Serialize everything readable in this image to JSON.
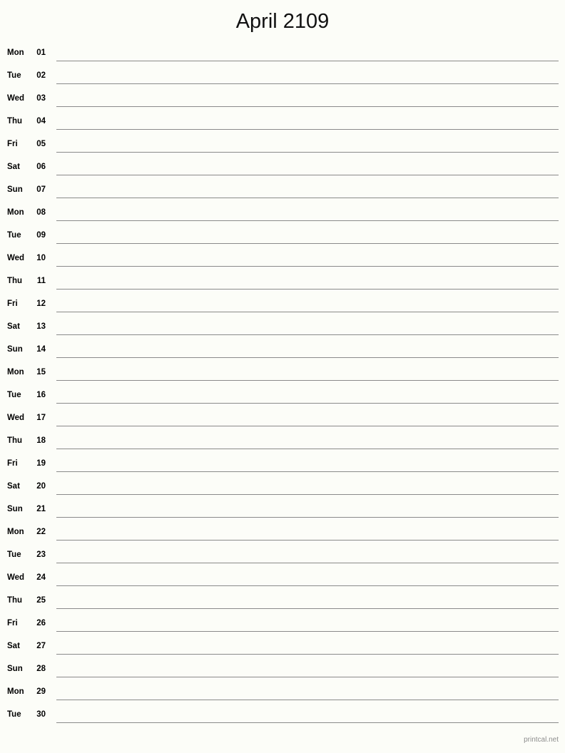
{
  "document": {
    "title": "April 2109",
    "month": "April",
    "year": "2109",
    "type": "printable-monthly-notes-calendar"
  },
  "footer": {
    "text": "printcal.net"
  },
  "colors": {
    "background": "#fcfdf8",
    "text": "#000000",
    "rule_line": "#8a8a8a",
    "footer_text": "#8d8d8d"
  },
  "days": [
    {
      "weekday": "Mon",
      "date": "01"
    },
    {
      "weekday": "Tue",
      "date": "02"
    },
    {
      "weekday": "Wed",
      "date": "03"
    },
    {
      "weekday": "Thu",
      "date": "04"
    },
    {
      "weekday": "Fri",
      "date": "05"
    },
    {
      "weekday": "Sat",
      "date": "06"
    },
    {
      "weekday": "Sun",
      "date": "07"
    },
    {
      "weekday": "Mon",
      "date": "08"
    },
    {
      "weekday": "Tue",
      "date": "09"
    },
    {
      "weekday": "Wed",
      "date": "10"
    },
    {
      "weekday": "Thu",
      "date": "11"
    },
    {
      "weekday": "Fri",
      "date": "12"
    },
    {
      "weekday": "Sat",
      "date": "13"
    },
    {
      "weekday": "Sun",
      "date": "14"
    },
    {
      "weekday": "Mon",
      "date": "15"
    },
    {
      "weekday": "Tue",
      "date": "16"
    },
    {
      "weekday": "Wed",
      "date": "17"
    },
    {
      "weekday": "Thu",
      "date": "18"
    },
    {
      "weekday": "Fri",
      "date": "19"
    },
    {
      "weekday": "Sat",
      "date": "20"
    },
    {
      "weekday": "Sun",
      "date": "21"
    },
    {
      "weekday": "Mon",
      "date": "22"
    },
    {
      "weekday": "Tue",
      "date": "23"
    },
    {
      "weekday": "Wed",
      "date": "24"
    },
    {
      "weekday": "Thu",
      "date": "25"
    },
    {
      "weekday": "Fri",
      "date": "26"
    },
    {
      "weekday": "Sat",
      "date": "27"
    },
    {
      "weekday": "Sun",
      "date": "28"
    },
    {
      "weekday": "Mon",
      "date": "29"
    },
    {
      "weekday": "Tue",
      "date": "30"
    }
  ]
}
